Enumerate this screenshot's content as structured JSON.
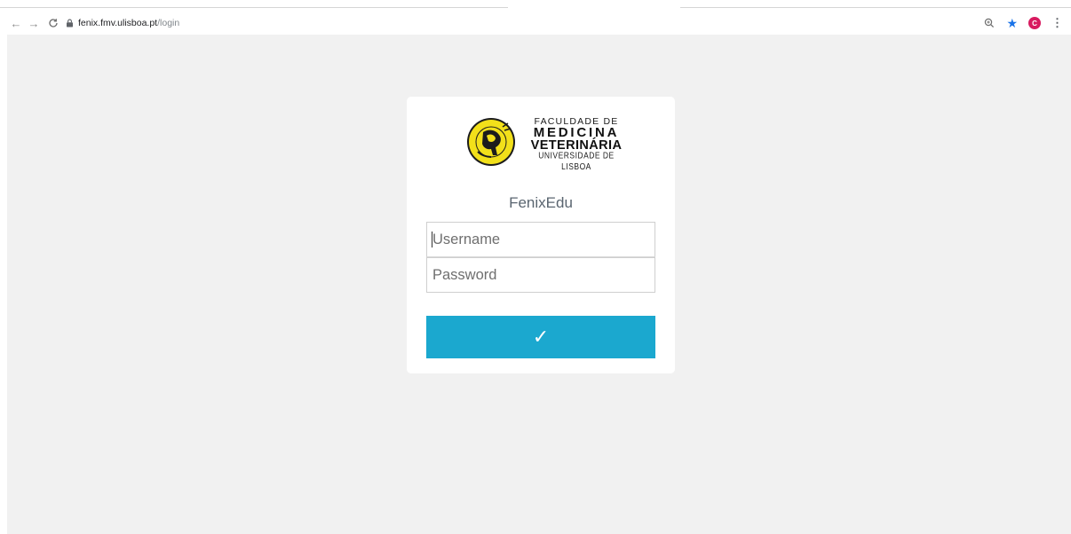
{
  "browser": {
    "url_host": "fenix.fmv.ulisboa.pt",
    "url_path": "/login",
    "avatar_letter": "C",
    "avatar_color": "#d81b60",
    "icons": [
      "back-icon",
      "forward-icon",
      "reload-icon",
      "lock-icon",
      "zoom-icon",
      "bookmark-star-icon",
      "kebab-menu-icon"
    ]
  },
  "logo": {
    "line1": "FACULDADE DE",
    "line2": "MEDICINA",
    "line3": "VETERINÁRIA",
    "line4": "UNIVERSIDADE DE LISBOA",
    "seal_color": "#f2e01a"
  },
  "login": {
    "title": "FenixEdu",
    "username_placeholder": "Username",
    "password_placeholder": "Password",
    "submit_symbol": "✓",
    "submit_color": "#1ba8cf"
  }
}
